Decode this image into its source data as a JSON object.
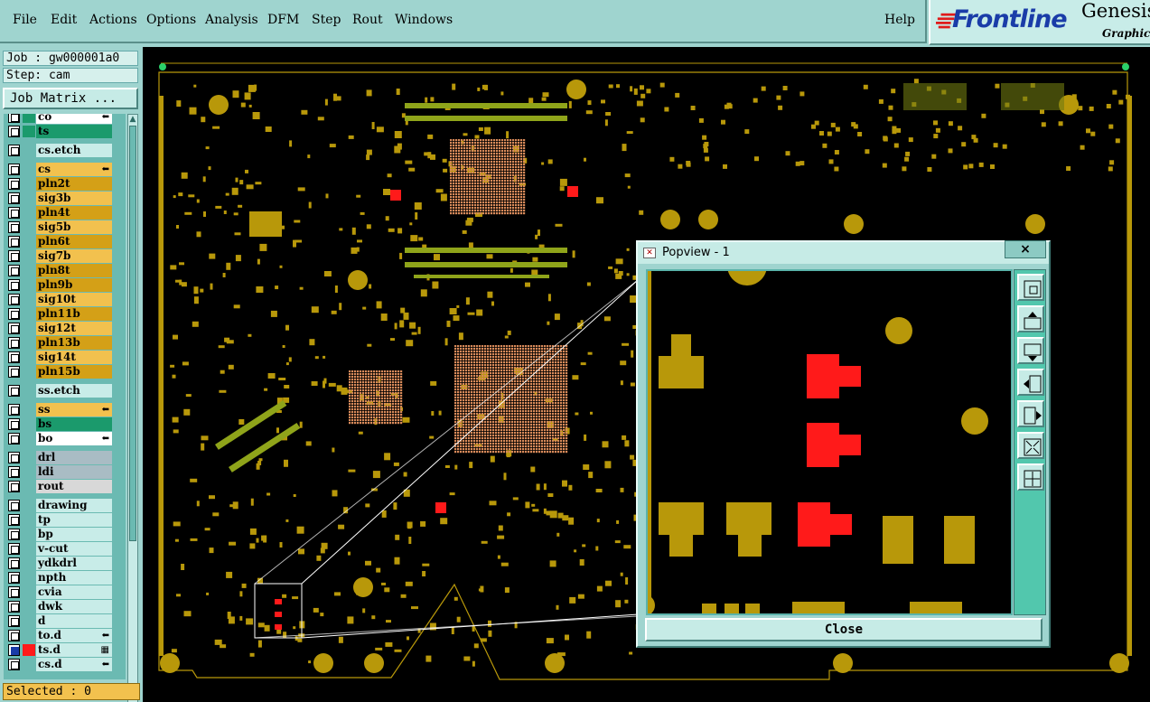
{
  "menu": {
    "items": [
      "File",
      "Edit",
      "Actions",
      "Options",
      "Analysis",
      "DFM",
      "Step",
      "Rout",
      "Windows"
    ],
    "help": "Help"
  },
  "brand": {
    "logo": "Frontline",
    "product": "Genesis",
    "subtitle": "Graphic"
  },
  "job": {
    "job_line": "Job : gw000001a0",
    "step_line": "Step: cam",
    "matrix_button": "Job Matrix ..."
  },
  "layers": [
    {
      "name": "co",
      "color": "#ffffff",
      "swatch": "#1b9a6c",
      "checked": false,
      "flag": "⬅"
    },
    {
      "name": "ts",
      "color": "#1b9a6c",
      "swatch": "#1b9a6c",
      "checked": false,
      "flag": ""
    },
    {
      "name": "cs.etch",
      "color": "#c8ece8",
      "swatch": "",
      "checked": false,
      "flag": "",
      "gap": true
    },
    {
      "name": "cs",
      "color": "#f2c14e",
      "swatch": "",
      "checked": false,
      "flag": "⬅",
      "gap": true
    },
    {
      "name": "pln2t",
      "color": "#d4a017",
      "swatch": "",
      "checked": false,
      "flag": ""
    },
    {
      "name": "sig3b",
      "color": "#f2c14e",
      "swatch": "",
      "checked": false,
      "flag": ""
    },
    {
      "name": "pln4t",
      "color": "#d4a017",
      "swatch": "",
      "checked": false,
      "flag": ""
    },
    {
      "name": "sig5b",
      "color": "#f2c14e",
      "swatch": "",
      "checked": false,
      "flag": ""
    },
    {
      "name": "pln6t",
      "color": "#d4a017",
      "swatch": "",
      "checked": false,
      "flag": ""
    },
    {
      "name": "sig7b",
      "color": "#f2c14e",
      "swatch": "",
      "checked": false,
      "flag": ""
    },
    {
      "name": "pln8t",
      "color": "#d4a017",
      "swatch": "",
      "checked": false,
      "flag": ""
    },
    {
      "name": "pln9b",
      "color": "#d4a017",
      "swatch": "",
      "checked": false,
      "flag": ""
    },
    {
      "name": "sig10t",
      "color": "#f2c14e",
      "swatch": "",
      "checked": false,
      "flag": ""
    },
    {
      "name": "pln11b",
      "color": "#d4a017",
      "swatch": "",
      "checked": false,
      "flag": ""
    },
    {
      "name": "sig12t",
      "color": "#f2c14e",
      "swatch": "",
      "checked": false,
      "flag": ""
    },
    {
      "name": "pln13b",
      "color": "#d4a017",
      "swatch": "",
      "checked": false,
      "flag": ""
    },
    {
      "name": "sig14t",
      "color": "#f2c14e",
      "swatch": "",
      "checked": false,
      "flag": ""
    },
    {
      "name": "pln15b",
      "color": "#d4a017",
      "swatch": "",
      "checked": false,
      "flag": ""
    },
    {
      "name": "ss.etch",
      "color": "#c8ece8",
      "swatch": "",
      "checked": false,
      "flag": "",
      "gap": true
    },
    {
      "name": "ss",
      "color": "#f2c14e",
      "swatch": "",
      "checked": false,
      "flag": "⬅",
      "gap": true
    },
    {
      "name": "bs",
      "color": "#1b9a6c",
      "swatch": "",
      "checked": false,
      "flag": ""
    },
    {
      "name": "bo",
      "color": "#ffffff",
      "swatch": "",
      "checked": false,
      "flag": "⬅"
    },
    {
      "name": "drl",
      "color": "#a9bcc4",
      "swatch": "",
      "checked": false,
      "flag": "",
      "gap": true
    },
    {
      "name": "ldi",
      "color": "#a9bcc4",
      "swatch": "",
      "checked": false,
      "flag": ""
    },
    {
      "name": "rout",
      "color": "#d8d8d8",
      "swatch": "",
      "checked": false,
      "flag": ""
    },
    {
      "name": "drawing",
      "color": "#c8ece8",
      "swatch": "",
      "checked": false,
      "flag": "",
      "gap": true
    },
    {
      "name": "tp",
      "color": "#c8ece8",
      "swatch": "",
      "checked": false,
      "flag": ""
    },
    {
      "name": "bp",
      "color": "#c8ece8",
      "swatch": "",
      "checked": false,
      "flag": ""
    },
    {
      "name": "v-cut",
      "color": "#c8ece8",
      "swatch": "",
      "checked": false,
      "flag": ""
    },
    {
      "name": "ydkdrl",
      "color": "#c8ece8",
      "swatch": "",
      "checked": false,
      "flag": ""
    },
    {
      "name": "npth",
      "color": "#c8ece8",
      "swatch": "",
      "checked": false,
      "flag": ""
    },
    {
      "name": "cvia",
      "color": "#c8ece8",
      "swatch": "",
      "checked": false,
      "flag": ""
    },
    {
      "name": "dwk",
      "color": "#c8ece8",
      "swatch": "",
      "checked": false,
      "flag": ""
    },
    {
      "name": "d",
      "color": "#c8ece8",
      "swatch": "",
      "checked": false,
      "flag": ""
    },
    {
      "name": "to.d",
      "color": "#c8ece8",
      "swatch": "",
      "checked": false,
      "flag": "⬅"
    },
    {
      "name": "ts.d",
      "color": "#c8ece8",
      "swatch": "#ff1a1a",
      "checked": true,
      "flag": "▦"
    },
    {
      "name": "cs.d",
      "color": "#c8ece8",
      "swatch": "",
      "checked": false,
      "flag": "⬅"
    }
  ],
  "status": {
    "selected": "Selected : 0"
  },
  "popview": {
    "title": "Popview - 1",
    "close_x": "×",
    "close_button": "Close",
    "tools": [
      "zoom-window-icon",
      "pan-up-icon",
      "pan-down-icon",
      "pan-left-icon",
      "pan-right-icon",
      "zoom-fit-icon",
      "zoom-center-icon"
    ]
  },
  "colors": {
    "pad": "#b8980a",
    "highlight": "#ff1a1a",
    "board_bg": "#000000",
    "ui_bg": "#9fd4cf"
  }
}
